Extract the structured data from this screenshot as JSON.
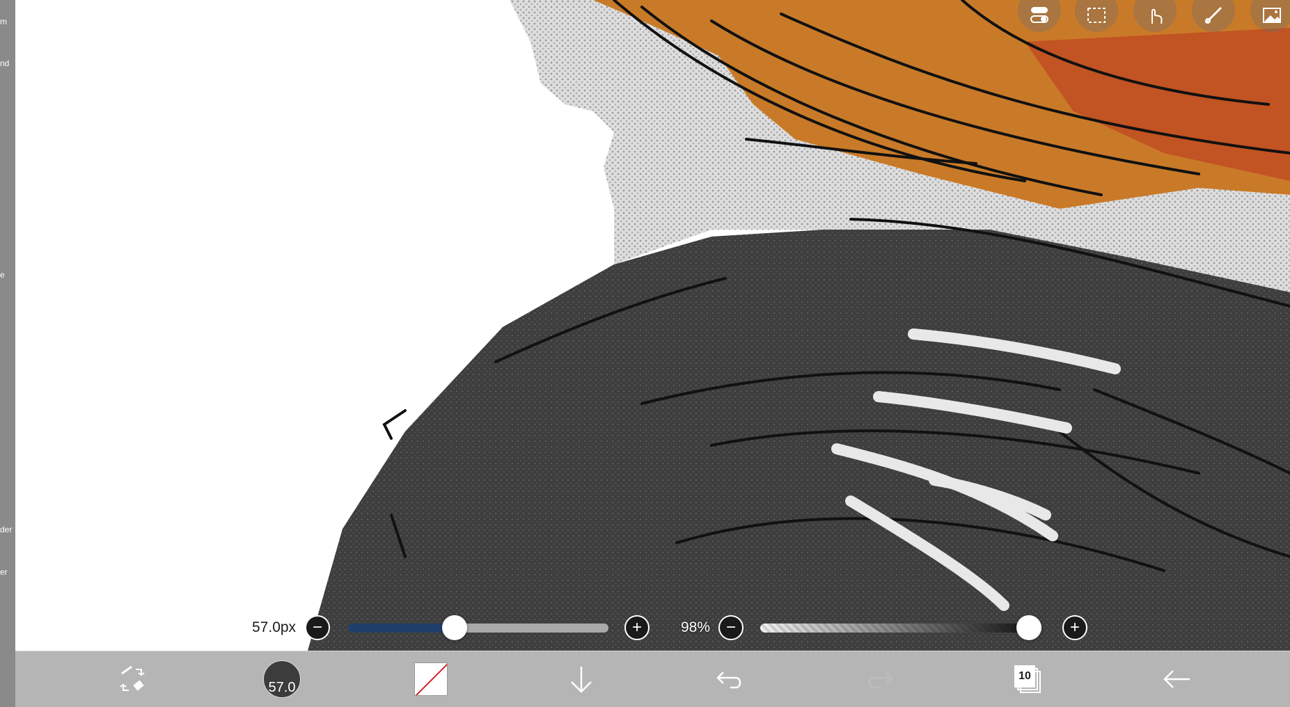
{
  "left_strip": {
    "fragments": [
      "m",
      "nd",
      "e",
      "der",
      "er"
    ]
  },
  "top_toolbar": {
    "items": [
      "settings-toggle-icon",
      "selection-icon",
      "hand-icon",
      "ruler-icon",
      "image-icon"
    ]
  },
  "brush_size": {
    "label": "57.0px",
    "value": 57.0,
    "slider_fraction": 0.41
  },
  "opacity": {
    "label": "98%",
    "value": 98,
    "slider_fraction": 0.98
  },
  "bottom_toolbar": {
    "brush_size_badge": "57.0",
    "layer_count": "10",
    "colors": {
      "size_fill": "#1f3f6b",
      "track": "#a9a9a9",
      "current_color": "#ffffff"
    }
  }
}
